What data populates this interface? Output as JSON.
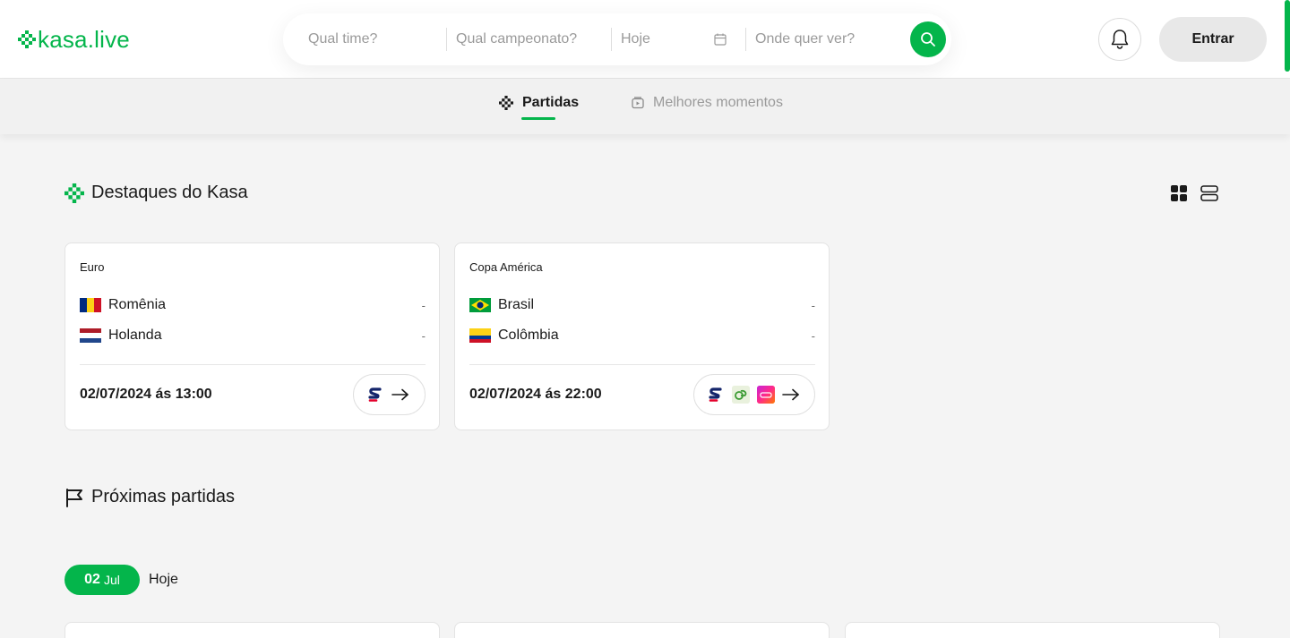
{
  "brand": {
    "name": "kasa.live",
    "accent": "#04b54b"
  },
  "search": {
    "team_placeholder": "Qual time?",
    "championship_placeholder": "Qual campeonato?",
    "date_value": "Hoje",
    "where_placeholder": "Onde quer ver?"
  },
  "header": {
    "login_label": "Entrar"
  },
  "tabs": [
    {
      "label": "Partidas",
      "active": true,
      "icon": "checkered-ball-icon"
    },
    {
      "label": "Melhores momentos",
      "active": false,
      "icon": "video-icon"
    }
  ],
  "featured": {
    "title": "Destaques do Kasa",
    "matches": [
      {
        "competition": "Euro",
        "home": {
          "name": "Romênia",
          "score": "-"
        },
        "away": {
          "name": "Holanda",
          "score": "-"
        },
        "datetime": "02/07/2024 ás 13:00",
        "providers": [
          "sportv"
        ]
      },
      {
        "competition": "Copa América",
        "home": {
          "name": "Brasil",
          "score": "-"
        },
        "away": {
          "name": "Colômbia",
          "score": "-"
        },
        "datetime": "02/07/2024 ás 22:00",
        "providers": [
          "sportv",
          "ge",
          "globo"
        ]
      }
    ]
  },
  "upcoming": {
    "title": "Próximas partidas",
    "date_chip": {
      "day": "02",
      "month": "Jul"
    },
    "date_label": "Hoje"
  }
}
